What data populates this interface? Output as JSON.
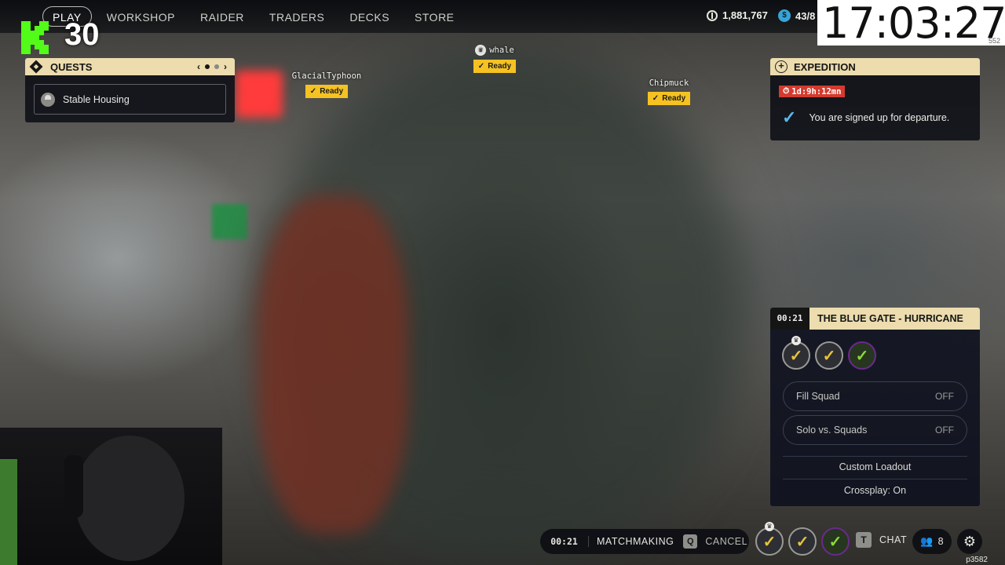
{
  "nav": {
    "items": [
      {
        "label": "PLAY",
        "active": true
      },
      {
        "label": "WORKSHOP",
        "active": false
      },
      {
        "label": "RAIDER",
        "active": false
      },
      {
        "label": "TRADERS",
        "active": false
      },
      {
        "label": "DECKS",
        "active": false
      },
      {
        "label": "STORE",
        "active": false
      }
    ]
  },
  "currency": {
    "coins": "1,881,767",
    "credits": "43/8"
  },
  "stream_overlay": {
    "logo_letter": "K",
    "count": "30",
    "clock": "17:03:27",
    "clock_sub": "552",
    "corner_id": "p3582"
  },
  "quests": {
    "title": "QUESTS",
    "prev": "‹",
    "next": "›",
    "item": "Stable Housing"
  },
  "players": [
    {
      "name": "GlacialTyphoon",
      "status": "Ready",
      "leader": false
    },
    {
      "name": "whale",
      "status": "Ready",
      "leader": true
    },
    {
      "name": "Chipmuck",
      "status": "Ready",
      "leader": false
    }
  ],
  "expedition": {
    "title": "EXPEDITION",
    "timer": "1d:9h:12mn",
    "message": "You are signed up for departure."
  },
  "squad": {
    "time": "00:21",
    "map": "THE BLUE GATE - HURRICANE",
    "fill_squad": {
      "label": "Fill Squad",
      "value": "OFF"
    },
    "solo_vs_squads": {
      "label": "Solo vs. Squads",
      "value": "OFF"
    },
    "custom_loadout": "Custom Loadout",
    "crossplay": "Crossplay: On"
  },
  "matchmaking": {
    "time": "00:21",
    "label": "MATCHMAKING",
    "cancel_key": "Q",
    "cancel_label": "CANCEL"
  },
  "chat": {
    "key": "T",
    "label": "CHAT"
  },
  "friends": {
    "count": "8"
  },
  "colors": {
    "accent_gold": "#ecdcae",
    "ready_yellow": "#f5c222",
    "timer_red": "#d33b2f",
    "check_blue": "#5ab6e6",
    "kick_green": "#53fc18"
  }
}
